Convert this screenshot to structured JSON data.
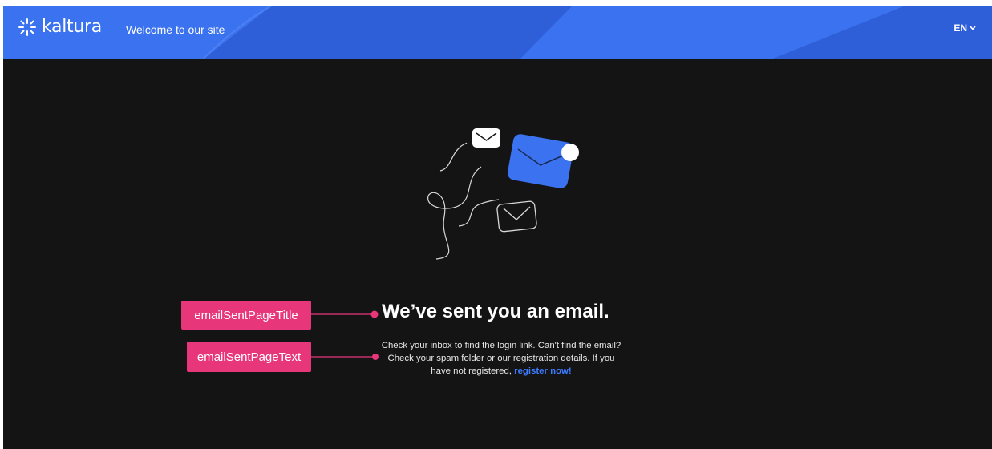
{
  "header": {
    "logo_text": "kaltura",
    "welcome": "Welcome to our site",
    "language": "EN"
  },
  "main": {
    "title": "We’ve sent you an email.",
    "text_before_link": "Check your inbox to find the login link. Can't find the email? Check your spam folder or our registration details. If you have not registered,",
    "link_label": "register now!"
  },
  "annotations": {
    "title_tag": "emailSentPageTitle",
    "text_tag": "emailSentPageText"
  },
  "colors": {
    "header_blue": "#3a72f0",
    "page_background": "#141414",
    "link_blue": "#3d7bff",
    "annotation_pink": "#e8367a"
  },
  "icons": [
    "kaltura-logo-icon",
    "chevron-down-icon",
    "envelope-icon"
  ]
}
